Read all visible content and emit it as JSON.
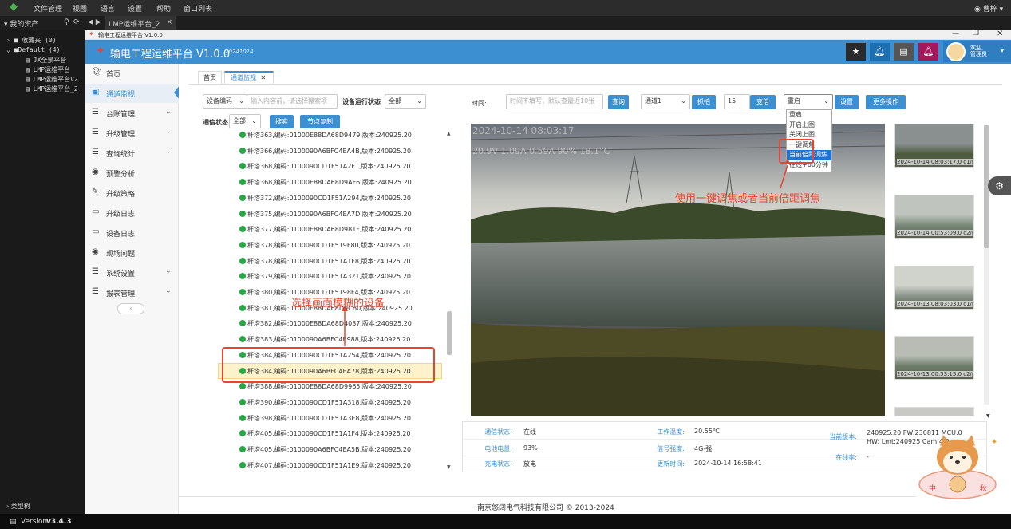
{
  "topbar": {
    "menus": [
      "文件管理",
      "视图",
      "语言",
      "设置",
      "帮助",
      "窗口列表"
    ],
    "user": "曹梓"
  },
  "tabbar": {
    "left_label": "我的资产",
    "tab_label": "LMP运维平台_2"
  },
  "asset_tree": {
    "items": [
      "收藏夹 (0)",
      "Default (4)",
      "JX全景平台",
      "LMP运维平台",
      "LMP运维平台V2",
      "LMP运维平台_2"
    ],
    "footer": "类型树"
  },
  "bottombar": {
    "version_label": "Version",
    "version": "v3.4.3"
  },
  "app": {
    "window_title": "输电工程运维平台 V1.0.0",
    "header_title": "输电工程运维平台 V1.0.0",
    "header_build": "20241014",
    "user_line1": "欢迎,",
    "user_line2": "管理员"
  },
  "sidenav": {
    "items": [
      {
        "label": "首页",
        "icon": "palette-icon",
        "has_children": false
      },
      {
        "label": "通道监视",
        "icon": "image-icon",
        "has_children": false,
        "active": true
      },
      {
        "label": "台账管理",
        "icon": "list-icon",
        "has_children": true
      },
      {
        "label": "升级管理",
        "icon": "list-icon",
        "has_children": true
      },
      {
        "label": "查询统计",
        "icon": "list-icon",
        "has_children": true
      },
      {
        "label": "预警分析",
        "icon": "eye-icon",
        "has_children": false
      },
      {
        "label": "升级策略",
        "icon": "edit-icon",
        "has_children": false
      },
      {
        "label": "升级日志",
        "icon": "monitor-icon",
        "has_children": false
      },
      {
        "label": "设备日志",
        "icon": "monitor-icon",
        "has_children": false
      },
      {
        "label": "现场问题",
        "icon": "eye-icon",
        "has_children": false
      },
      {
        "label": "系统设置",
        "icon": "list-icon",
        "has_children": true
      },
      {
        "label": "报表管理",
        "icon": "list-icon",
        "has_children": true
      }
    ]
  },
  "page_tabs": {
    "home": "首页",
    "current": "通道监视"
  },
  "filters": {
    "device_code_select": "设备编码",
    "keyword_placeholder": "输入内容前，请选择搜索项",
    "run_status_label": "设备运行状态",
    "run_status_value": "全部",
    "comm_status_label": "通信状态",
    "comm_status_value": "全部",
    "search_btn": "搜索",
    "copy_btn": "节点复制"
  },
  "devices": [
    "杆塔363,编码:01000E88DA68D9479,版本:240925.20",
    "杆塔366,编码:0100090A6BFC4EA4B,版本:240925.20",
    "杆塔368,编码:0100090CD1F51A2F1,版本:240925.20",
    "杆塔368,编码:01000E88DA68D9AF6,版本:240925.20",
    "杆塔372,编码:0100090CD1F51A294,版本:240925.20",
    "杆塔375,编码:0100090A6BFC4EA7D,版本:240925.20",
    "杆塔377,编码:01000E88DA68D981F,版本:240925.20",
    "杆塔378,编码:0100090CD1F519F80,版本:240925.20",
    "杆塔378,编码:0100090CD1F51A1F8,版本:240925.20",
    "杆塔379,编码:0100090CD1F51A321,版本:240925.20",
    "杆塔380,编码:0100090CD1F5198F4,版本:240925.20",
    "杆塔381,编码:01000E88DA68D9CB0,版本:240925.20",
    "杆塔382,编码:01000E88DA68D4037,版本:240925.20",
    "杆塔383,编码:0100090A6BFC4E988,版本:240925.20",
    "杆塔384,编码:0100090CD1F51A254,版本:240925.20",
    "杆塔384,编码:0100090A6BFC4EA78,版本:240925.20",
    "杆塔388,编码:01000E88DA68D9965,版本:240925.20",
    "杆塔390,编码:0100090CD1F51A318,版本:240925.20",
    "杆塔398,编码:0100090CD1F51A3E8,版本:240925.20",
    "杆塔405,编码:0100090CD1F51A1F4,版本:240925.20",
    "杆塔405,编码:0100090A6BFC4EA5B,版本:240925.20",
    "杆塔407,编码:0100090CD1F51A1E9,版本:240925.20"
  ],
  "toolbar": {
    "time_label": "时间:",
    "time_placeholder": "时间不填写，默认查最近10张",
    "query_btn": "查询",
    "channel_value": "通道1",
    "capture_btn": "抓拍",
    "num_value": "15",
    "zoom_btn": "变倍",
    "cmd_value": "重启",
    "set_btn": "设置",
    "more_btn": "更多操作",
    "dropdown_options": [
      "重启",
      "开启上图",
      "关闭上图",
      "一键调焦",
      "当前倍距调焦",
      "在线+60分钟"
    ],
    "dropdown_selected_index": 4
  },
  "image": {
    "overlay_time": "2024-10-14 08:03:17",
    "overlay_stats": "20.9V 1.09A 0.59A 90% 18.1°C"
  },
  "thumbnails": [
    "2024-10-14 08:03:17.0 c1/p0",
    "2024-10-14 00:53:09.0 c2/p0",
    "2024-10-13 08:03:03.0 c1/p0",
    "2024-10-13 00:53:15.0 c2/p0"
  ],
  "info": {
    "comm_status_label": "通信状态:",
    "comm_status": "在线",
    "battery_label": "电池电量:",
    "battery": "93%",
    "charge_label": "充电状态:",
    "charge": "放电",
    "temp_label": "工作温度:",
    "temp": "20.55℃",
    "signal_label": "信号强度:",
    "signal": "4G-强",
    "update_label": "更新时间:",
    "update": "2024-10-14 16:58:41",
    "version_label": "当前版本:",
    "version_line1": "240925.20 FW:230811 MCU:0",
    "version_line2": "HW: Lmt:240925 Cam:4.0",
    "online_rate_label": "在线率:",
    "online_rate": "-"
  },
  "annotations": {
    "focus_note": "使用一键调焦或者当前倍距调焦",
    "select_note": "选择画面模糊的设备"
  },
  "footer": "南京悠阔电气科技有限公司 © 2013-2024",
  "colors": {
    "header_blue": "#3c8fd0",
    "annotation_red": "#e8452c",
    "online_green": "#28a745"
  }
}
